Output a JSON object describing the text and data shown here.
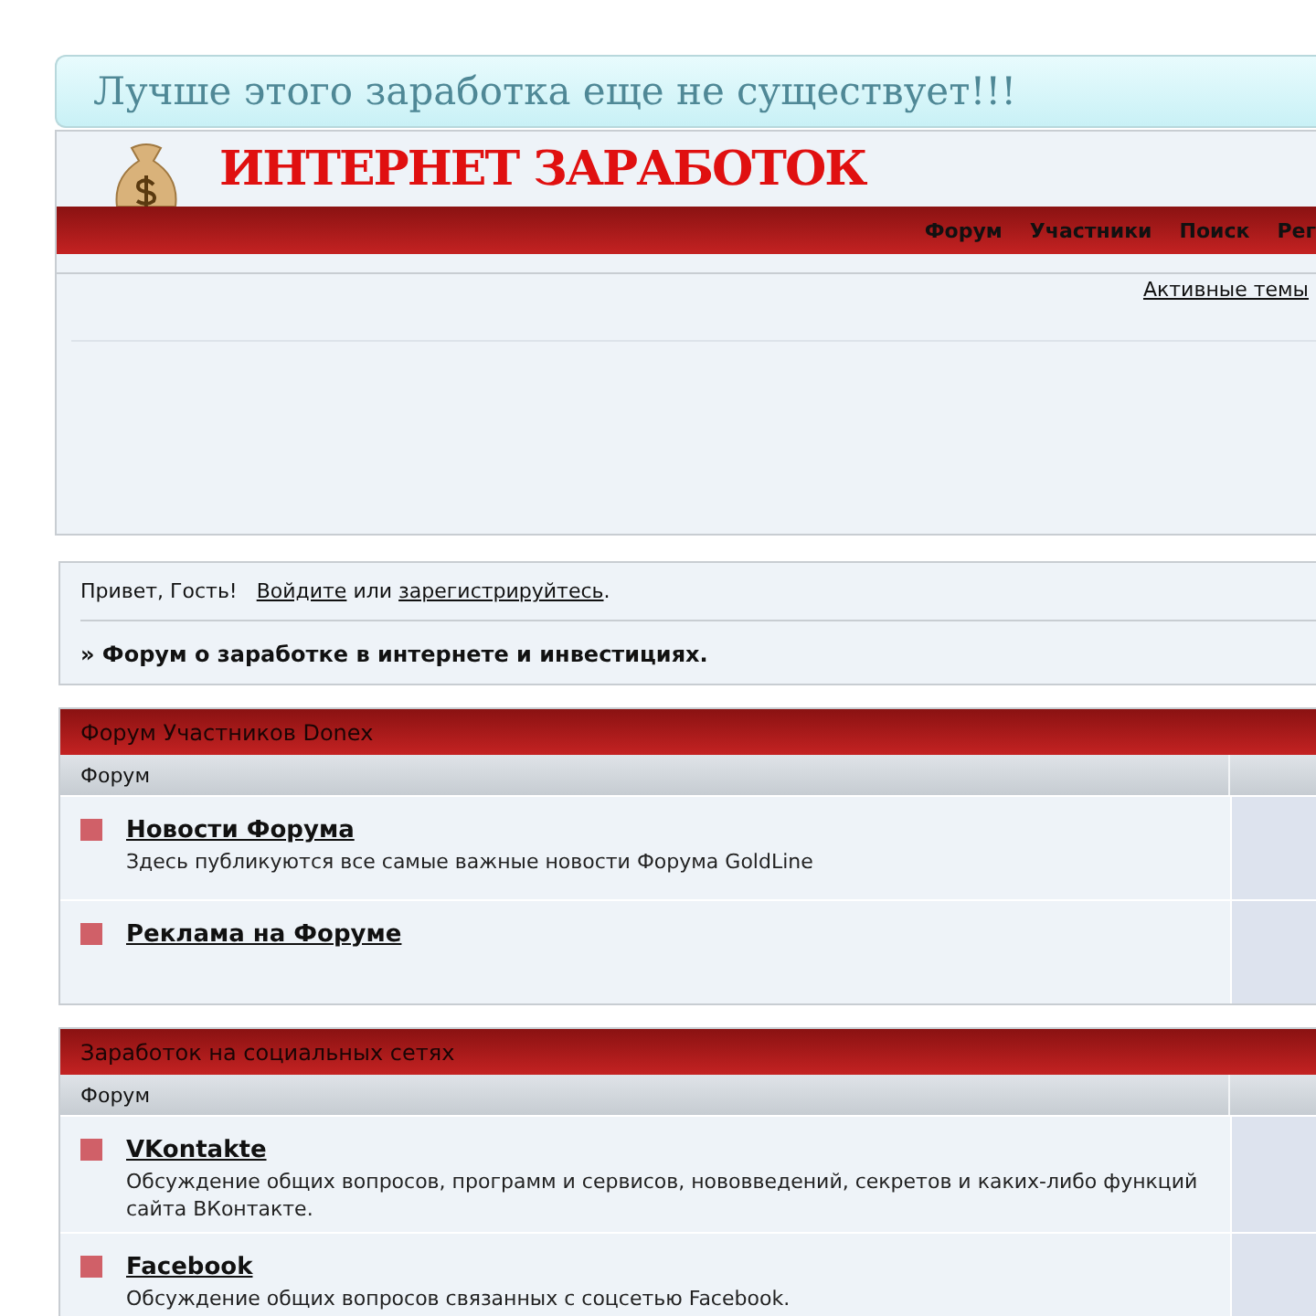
{
  "slogan": "Лучше этого заработка еще не существует!!!",
  "logo": {
    "title": "ИНТЕРНЕТ ЗАРАБОТОК"
  },
  "nav": [
    "Форум",
    "Участники",
    "Поиск",
    "Рег"
  ],
  "active_topics": "Активные темы",
  "greeting": {
    "text": "Привет, Гость!",
    "login": "Войдите",
    "or": "или",
    "register": "зарегистрируйтесь",
    "end": "."
  },
  "breadcrumb": "» Форум о заработке в интернете и инвестициях.",
  "categories": [
    {
      "title": "Форум Участников Donex",
      "column_1": "Форум",
      "forums": [
        {
          "name": "Новости Форума",
          "description": "Здесь публикуются все самые важные новости Форума GoldLine"
        },
        {
          "name": "Реклама на Форуме"
        }
      ]
    },
    {
      "title": "Заработок на социальных сетях",
      "column_1": "Форум",
      "forums": [
        {
          "name": "VKontakte",
          "description": "Обсуждение общих вопросов, программ и сервисов, нововведений, секретов и каких-либо функций сайта ВКонтакте."
        },
        {
          "name": "Facebook",
          "description": "Обсуждение общих вопросов связанных с соцсетью Facebook."
        }
      ]
    }
  ]
}
